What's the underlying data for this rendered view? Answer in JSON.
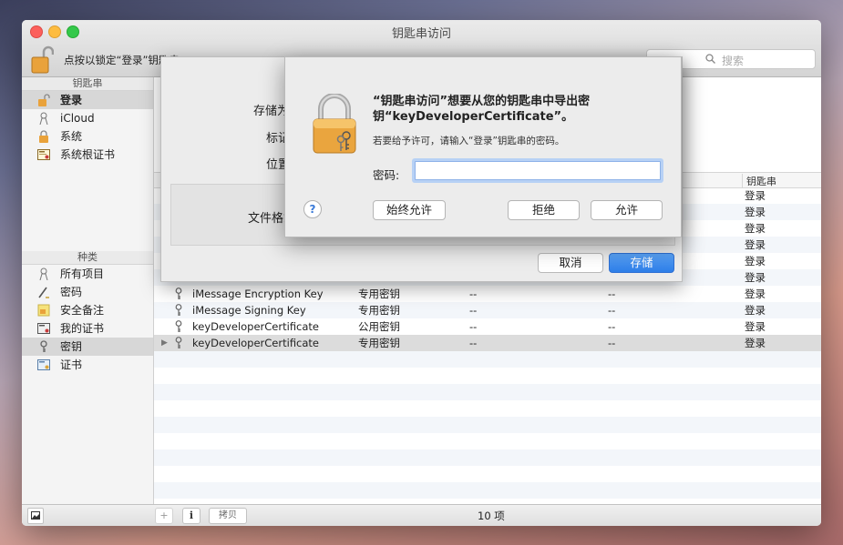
{
  "window": {
    "title": "钥匙串访问",
    "lock_hint": "点按以锁定“登录”钥匙串。",
    "search": {
      "placeholder": "搜索"
    }
  },
  "sidebar": {
    "keychains_header": "钥匙串",
    "keychains": [
      {
        "label": "登录",
        "icon": "unlocked-padlock-icon",
        "selected": true
      },
      {
        "label": "iCloud",
        "icon": "person-icon"
      },
      {
        "label": "系统",
        "icon": "padlock-icon"
      },
      {
        "label": "系统根证书",
        "icon": "certificate-icon"
      }
    ],
    "categories_header": "种类",
    "categories": [
      {
        "label": "所有项目",
        "icon": "person-icon"
      },
      {
        "label": "密码",
        "icon": "pen-icon"
      },
      {
        "label": "安全备注",
        "icon": "note-icon"
      },
      {
        "label": "我的证书",
        "icon": "certificate-icon"
      },
      {
        "label": "密钥",
        "icon": "key-icon",
        "selected": true
      },
      {
        "label": "证书",
        "icon": "certificate-icon"
      }
    ]
  },
  "table": {
    "keychain_col": "钥匙串",
    "rows": [
      {
        "name": "",
        "kind": "",
        "c3": "",
        "c4": "",
        "keychain": "登录"
      },
      {
        "name": "",
        "kind": "",
        "c3": "",
        "c4": "",
        "keychain": "登录"
      },
      {
        "name": "",
        "kind": "",
        "c3": "",
        "c4": "",
        "keychain": "登录"
      },
      {
        "name": "",
        "kind": "",
        "c3": "",
        "c4": "",
        "keychain": "登录"
      },
      {
        "name": "",
        "kind": "",
        "c3": "",
        "c4": "",
        "keychain": "登录"
      },
      {
        "name": "",
        "kind": "",
        "c3": "",
        "c4": "",
        "keychain": "登录"
      },
      {
        "name": "iMessage Encryption Key",
        "kind": "专用密钥",
        "c3": "--",
        "c4": "--",
        "keychain": "登录"
      },
      {
        "name": "iMessage Signing Key",
        "kind": "专用密钥",
        "c3": "--",
        "c4": "--",
        "keychain": "登录"
      },
      {
        "name": "keyDeveloperCertificate",
        "kind": "公用密钥",
        "c3": "--",
        "c4": "--",
        "keychain": "登录"
      },
      {
        "name": "keyDeveloperCertificate",
        "kind": "专用密钥",
        "c3": "--",
        "c4": "--",
        "keychain": "登录",
        "selected": true
      }
    ]
  },
  "bottombar": {
    "add": "+",
    "info": "i",
    "copy": "拷贝",
    "count": "10 项"
  },
  "save_sheet": {
    "save_as_label": "存储为",
    "tags_label": "标记",
    "where_label": "位置",
    "format_label": "文件格式",
    "cancel": "取消",
    "save": "存储"
  },
  "dialog": {
    "title": "“钥匙串访问”想要从您的钥匙串中导出密钥“keyDeveloperCertificate”。",
    "subtitle": "若要给予许可，请输入“登录”钥匙串的密码。",
    "password_label": "密码:",
    "password_value": "",
    "help": "?",
    "always_allow": "始终允许",
    "deny": "拒绝",
    "allow": "允许"
  }
}
